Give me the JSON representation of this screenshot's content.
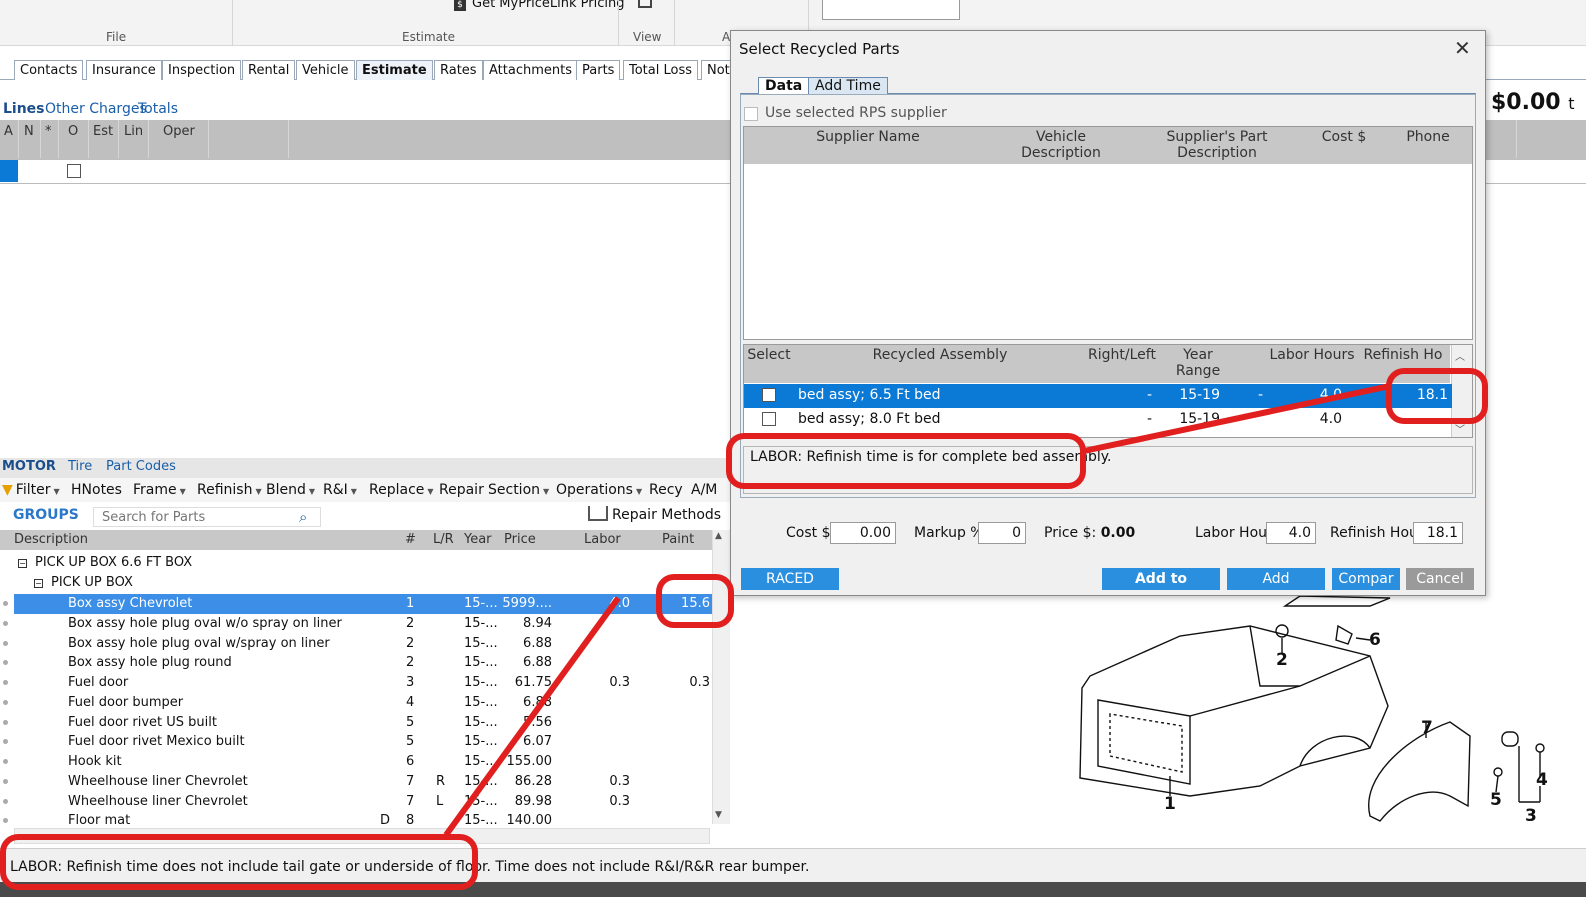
{
  "ribbon": {
    "groups": [
      "File",
      "Estimate",
      "View",
      "A"
    ],
    "get_pricing_label": "Get MyPriceLink Pricing"
  },
  "tabs": [
    "Contacts",
    "Insurance",
    "Inspection",
    "Rental",
    "Vehicle",
    "Estimate",
    "Rates",
    "Attachments",
    "Parts",
    "Total Loss",
    "Not"
  ],
  "subtabs": [
    "Lines",
    "Other Charges",
    "Totals"
  ],
  "lines_grid": {
    "columns": [
      "A",
      "N",
      "*",
      "O",
      "Est",
      "Lin",
      "Oper"
    ],
    "total": "$0.00",
    "total_suffix": "t"
  },
  "motor_tabs": [
    "MOTOR",
    "Tire",
    "Part Codes"
  ],
  "toolbar": [
    "Filter",
    "HNotes",
    "Frame",
    "Refinish",
    "Blend",
    "R&I",
    "Replace",
    "Repair",
    "Section",
    "Operations",
    "Recy",
    "A/M"
  ],
  "groups": {
    "label": "GROUPS",
    "search_placeholder": "Search for Parts",
    "repair_methods": "Repair Methods"
  },
  "parts_table": {
    "columns": [
      "Description",
      "#",
      "L/R",
      "Year",
      "Price",
      "Labor",
      "Paint"
    ],
    "group_header": "PICK UP BOX 6.6 FT BOX",
    "sub_header": "PICK UP BOX",
    "rows": [
      {
        "desc": "Box assy Chevrolet",
        "flag": "",
        "num": "1",
        "lr": "",
        "year": "15-...",
        "price": "5999....",
        "labor": "4.0",
        "paint": "15.6",
        "selected": true
      },
      {
        "desc": "Box assy hole plug oval w/o spray on liner",
        "flag": "",
        "num": "2",
        "lr": "",
        "year": "15-...",
        "price": "8.94",
        "labor": "",
        "paint": ""
      },
      {
        "desc": "Box assy hole plug oval w/spray on liner",
        "flag": "",
        "num": "2",
        "lr": "",
        "year": "15-...",
        "price": "6.88",
        "labor": "",
        "paint": ""
      },
      {
        "desc": "Box assy hole plug round",
        "flag": "",
        "num": "2",
        "lr": "",
        "year": "15-...",
        "price": "6.88",
        "labor": "",
        "paint": ""
      },
      {
        "desc": "Fuel door",
        "flag": "",
        "num": "3",
        "lr": "",
        "year": "15-...",
        "price": "61.75",
        "labor": "0.3",
        "paint": "0.3"
      },
      {
        "desc": "Fuel door bumper",
        "flag": "",
        "num": "4",
        "lr": "",
        "year": "15-...",
        "price": "6.88",
        "labor": "",
        "paint": ""
      },
      {
        "desc": "Fuel door rivet US built",
        "flag": "",
        "num": "5",
        "lr": "",
        "year": "15-...",
        "price": "5.56",
        "labor": "",
        "paint": ""
      },
      {
        "desc": "Fuel door rivet Mexico built",
        "flag": "",
        "num": "5",
        "lr": "",
        "year": "15-...",
        "price": "6.07",
        "labor": "",
        "paint": ""
      },
      {
        "desc": "Hook kit",
        "flag": "",
        "num": "6",
        "lr": "",
        "year": "15-...",
        "price": "155.00",
        "labor": "",
        "paint": ""
      },
      {
        "desc": "Wheelhouse liner Chevrolet",
        "flag": "",
        "num": "7",
        "lr": "R",
        "year": "15-...",
        "price": "86.28",
        "labor": "0.3",
        "paint": ""
      },
      {
        "desc": "Wheelhouse liner Chevrolet",
        "flag": "",
        "num": "7",
        "lr": "L",
        "year": "15-...",
        "price": "89.98",
        "labor": "0.3",
        "paint": ""
      },
      {
        "desc": "Floor mat",
        "flag": "D",
        "num": "8",
        "lr": "",
        "year": "15-...",
        "price": "140.00",
        "labor": "",
        "paint": ""
      }
    ]
  },
  "status_text": "LABOR: Refinish time does not include tail gate or underside of floor. Time does not include R&I/R&R rear bumper.",
  "dialog": {
    "title": "Select Recycled Parts",
    "tabs": [
      "Data",
      "Add Time"
    ],
    "use_supplier_label": "Use selected RPS supplier",
    "supplier_columns": [
      "Supplier Name",
      "Vehicle Description",
      "Supplier's Part Description",
      "Cost $",
      "Phone"
    ],
    "assembly_columns": [
      "Select",
      "Recycled Assembly",
      "Right/Left",
      "Year Range",
      "",
      "Labor Hours",
      "Refinish Ho"
    ],
    "assembly_rows": [
      {
        "name": "bed assy; 6.5 Ft bed",
        "rl": "-",
        "year": "15-19",
        "extra": "-",
        "labor": "4.0",
        "refinish": "18.1",
        "selected": true
      },
      {
        "name": "bed assy; 8.0 Ft bed",
        "rl": "-",
        "year": "15-19",
        "extra": "",
        "labor": "4.0",
        "refinish": "",
        "selected": false
      }
    ],
    "note": "LABOR: Refinish time is for complete bed assembly.",
    "cost_label": "Cost $:",
    "cost_value": "0.00",
    "markup_label": "Markup %:",
    "markup_value": "0",
    "price_label": "Price $:",
    "price_value": "0.00",
    "labor_hours_label": "Labor Hours",
    "labor_hours_value": "4.0",
    "refinish_hours_label": "Refinish Hours",
    "refinish_hours_value": "18.1",
    "buttons": {
      "raced": "RACED",
      "add_to": "Add to",
      "add": "Add",
      "compare": "Compar",
      "cancel": "Cancel"
    }
  },
  "diagram_callouts": [
    "1",
    "2",
    "3",
    "4",
    "5",
    "6",
    "7"
  ],
  "colors": {
    "accent": "#0b7ad6",
    "annotation": "#e11f1f",
    "selection": "#3c8ee6"
  }
}
